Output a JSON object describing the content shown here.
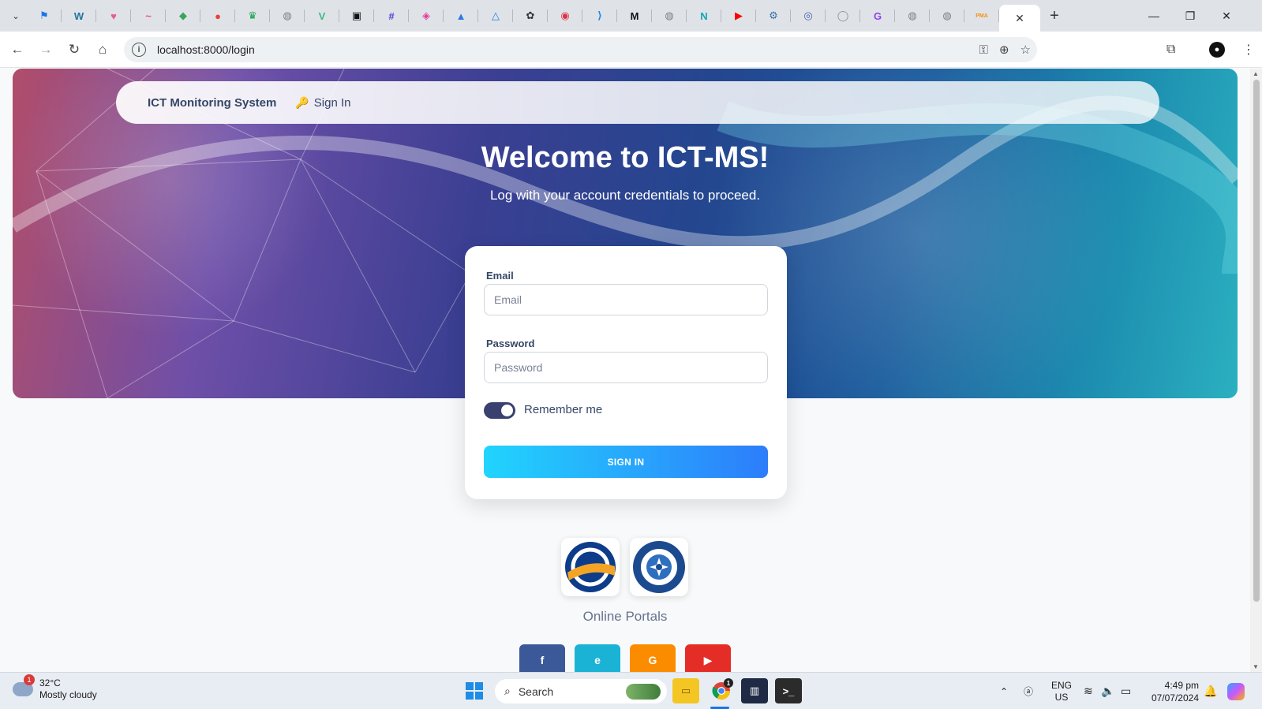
{
  "browser": {
    "tab_favicons": [
      {
        "icon": "flag-icon",
        "color": "#1a73e8",
        "glyph": "⚑"
      },
      {
        "icon": "wordpress-icon",
        "color": "#21759b",
        "glyph": "W"
      },
      {
        "icon": "shield-heart-icon",
        "color": "#e35d8f",
        "glyph": "♥"
      },
      {
        "icon": "tilde-icon",
        "color": "#e84e8a",
        "glyph": "~"
      },
      {
        "icon": "leaf-icon",
        "color": "#3ba55d",
        "glyph": "◆"
      },
      {
        "icon": "maps-pin-icon",
        "color": "#ea4335",
        "glyph": "●"
      },
      {
        "icon": "crown-icon",
        "color": "#16a34a",
        "glyph": "♛"
      },
      {
        "icon": "globe-icon",
        "color": "#7a7f85",
        "glyph": "◍"
      },
      {
        "icon": "vue-icon",
        "color": "#41b883",
        "glyph": "V"
      },
      {
        "icon": "square-dot-icon",
        "color": "#111111",
        "glyph": "▣"
      },
      {
        "icon": "hash-icon",
        "color": "#5b3fd6",
        "glyph": "#"
      },
      {
        "icon": "cube-icon",
        "color": "#e53a9b",
        "glyph": "◈"
      },
      {
        "icon": "triangle-icon",
        "color": "#2a7ae2",
        "glyph": "▲"
      },
      {
        "icon": "triangle-outline-icon",
        "color": "#2a7ae2",
        "glyph": "△"
      },
      {
        "icon": "openai-icon",
        "color": "#333333",
        "glyph": "✿"
      },
      {
        "icon": "record-icon",
        "color": "#e0334a",
        "glyph": "◉"
      },
      {
        "icon": "vscode-icon",
        "color": "#1e88e5",
        "glyph": "⟩"
      },
      {
        "icon": "medium-icon",
        "color": "#111111",
        "glyph": "M"
      },
      {
        "icon": "globe-icon",
        "color": "#7a7f85",
        "glyph": "◍"
      },
      {
        "icon": "n-logo-icon",
        "color": "#12a5b8",
        "glyph": "N"
      },
      {
        "icon": "youtube-icon",
        "color": "#ff0000",
        "glyph": "▶"
      },
      {
        "icon": "gear-circle-icon",
        "color": "#3a6ea5",
        "glyph": "⚙"
      },
      {
        "icon": "portal-icon",
        "color": "#4a5fa8",
        "glyph": "◎"
      },
      {
        "icon": "github-icon",
        "color": "#8a8f95",
        "glyph": "◯"
      },
      {
        "icon": "g-logo-icon",
        "color": "#8e44ef",
        "glyph": "G"
      },
      {
        "icon": "globe-icon",
        "color": "#7a7f85",
        "glyph": "◍"
      },
      {
        "icon": "globe-icon",
        "color": "#7a7f85",
        "glyph": "◍"
      },
      {
        "icon": "phpmyadmin-icon",
        "color": "#f29111",
        "glyph": "PMA"
      }
    ],
    "active_tab_close": "✕",
    "new_tab": "+",
    "url": "localhost:8000/login"
  },
  "page": {
    "navbar": {
      "brand": "ICT Monitoring System",
      "signin_link": "Sign In"
    },
    "hero_title": "Welcome to ICT-MS!",
    "hero_subtitle": "Log with your account credentials to proceed.",
    "form": {
      "email_label": "Email",
      "email_placeholder": "Email",
      "email_value": "",
      "password_label": "Password",
      "password_placeholder": "Password",
      "password_value": "",
      "remember_label": "Remember me",
      "remember_checked": true,
      "submit_label": "SIGN IN"
    },
    "online_portals_label": "Online Portals",
    "social_buttons": [
      {
        "icon": "facebook-icon",
        "glyph": "f",
        "color": "#3b5998"
      },
      {
        "icon": "edge-icon",
        "glyph": "e",
        "color": "#1ab3d6"
      },
      {
        "icon": "google-icon",
        "glyph": "G",
        "color": "#fb8c00"
      },
      {
        "icon": "youtube-icon",
        "glyph": "▶",
        "color": "#e52d27"
      }
    ],
    "colors": {
      "accent_gradient_start": "#21d4fd",
      "accent_gradient_end": "#2d7dfb",
      "toggle_on": "#3a416f"
    }
  },
  "taskbar": {
    "weather_temp": "32°C",
    "weather_desc": "Mostly cloudy",
    "weather_badge": "1",
    "search_label": "Search",
    "chrome_badge": "1",
    "lang_top": "ENG",
    "lang_bottom": "US",
    "time": "4:49 pm",
    "date": "07/07/2024"
  }
}
